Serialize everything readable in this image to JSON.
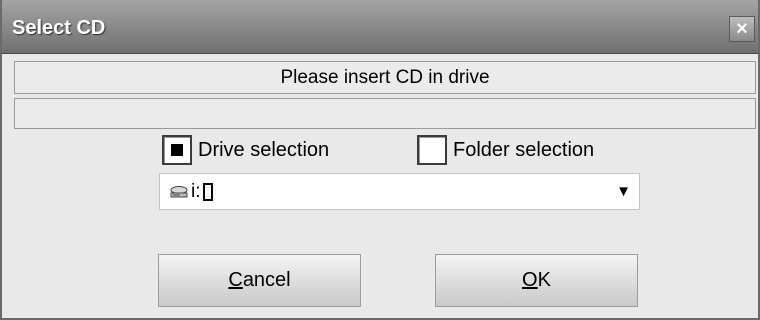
{
  "window": {
    "title": "Select CD",
    "close_label": "×"
  },
  "message": {
    "text": "Please insert CD in drive"
  },
  "source_mode": {
    "drive_label": "Drive selection",
    "drive_selected": true,
    "folder_label": "Folder selection",
    "folder_selected": false
  },
  "drive_combo": {
    "value": "i:",
    "icon": "cd-drive-icon",
    "arrow": "▼"
  },
  "buttons": {
    "cancel_mnemonic": "C",
    "cancel_rest": "ancel",
    "ok_mnemonic": "O",
    "ok_rest": "K"
  }
}
